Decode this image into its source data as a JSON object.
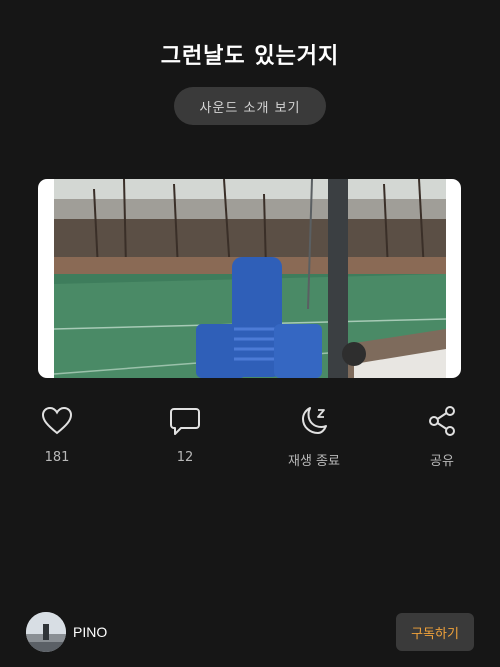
{
  "header": {
    "title": "그런날도 있는거지"
  },
  "sound_button": {
    "label": "사운드 소개 보기"
  },
  "photo": {
    "icon": "photo-image"
  },
  "actions": {
    "like": {
      "icon": "heart-icon",
      "label": "181"
    },
    "comment": {
      "icon": "speech-bubble-icon",
      "label": "12"
    },
    "sleep": {
      "icon": "moon-z-icon",
      "label": "재생 종료"
    },
    "share": {
      "icon": "share-icon",
      "label": "공유"
    }
  },
  "footer": {
    "channel_name": "PINO",
    "subscribe_label": "구독하기"
  },
  "colors": {
    "background": "#161616",
    "button_bg": "#3a3a3a",
    "subscribe_text": "#f0a23a"
  }
}
